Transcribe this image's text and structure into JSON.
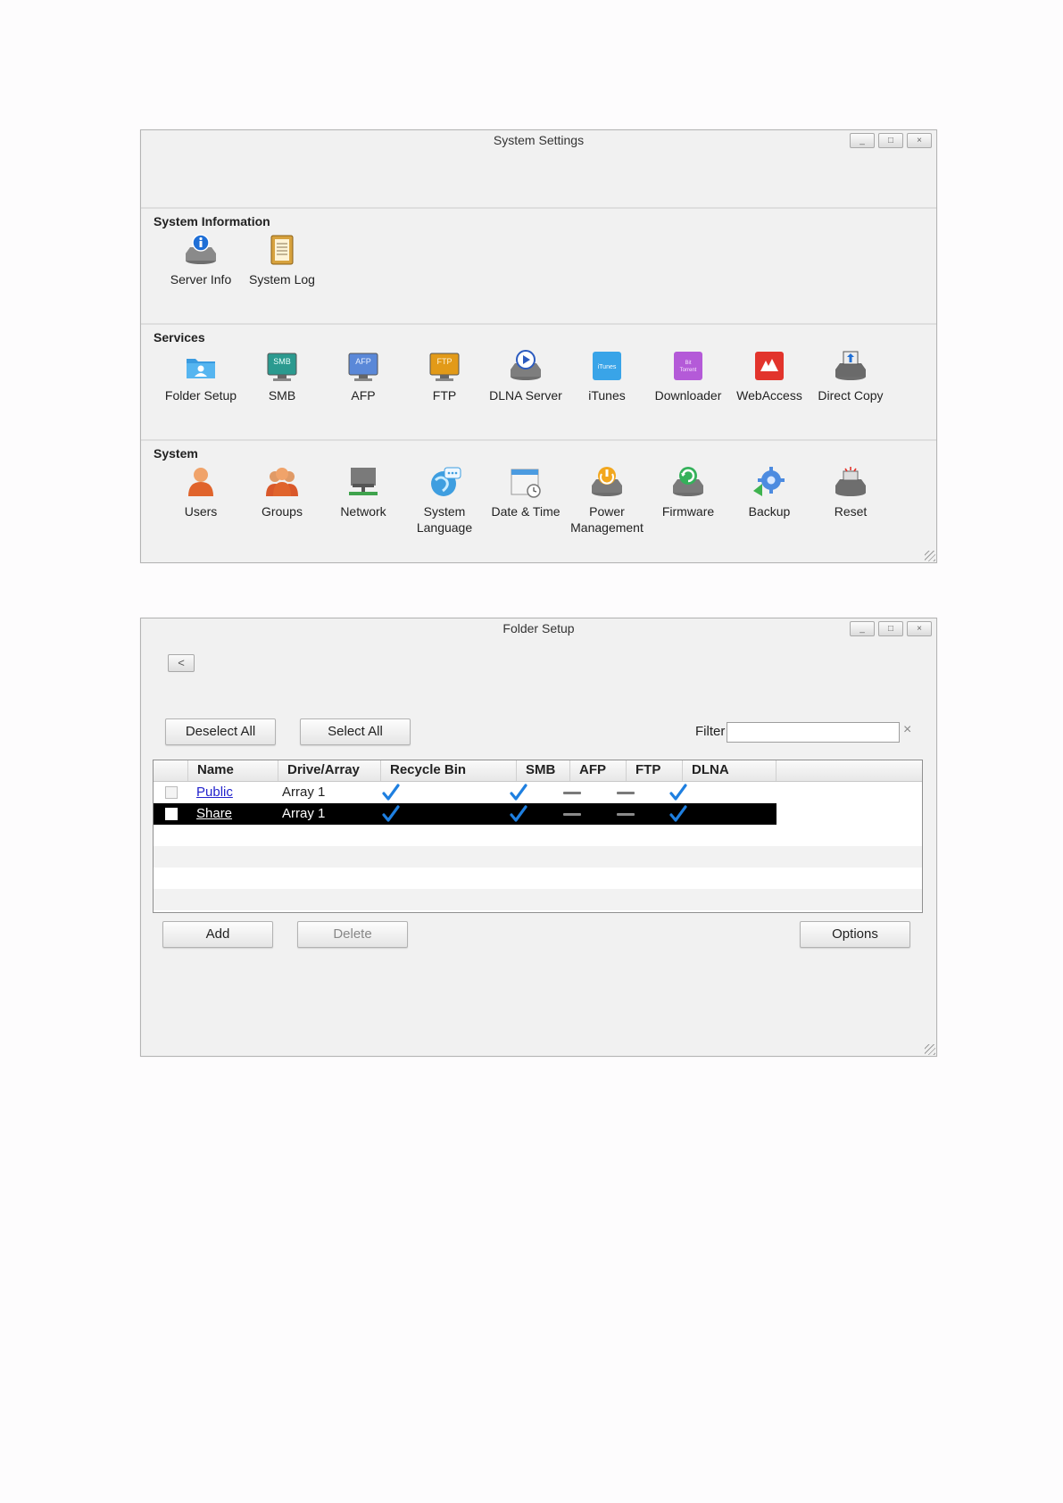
{
  "win1": {
    "title": "System Settings",
    "sections": [
      {
        "title": "System Information",
        "items": [
          {
            "label": "Server Info",
            "icon": "server-info-icon"
          },
          {
            "label": "System Log",
            "icon": "system-log-icon"
          }
        ]
      },
      {
        "title": "Services",
        "items": [
          {
            "label": "Folder Setup",
            "icon": "folder-setup-icon"
          },
          {
            "label": "SMB",
            "icon": "smb-icon",
            "badge": "SMB"
          },
          {
            "label": "AFP",
            "icon": "afp-icon",
            "badge": "AFP"
          },
          {
            "label": "FTP",
            "icon": "ftp-icon",
            "badge": "FTP"
          },
          {
            "label": "DLNA Server",
            "icon": "dlna-server-icon"
          },
          {
            "label": "iTunes",
            "icon": "itunes-icon",
            "badge": "iTunes"
          },
          {
            "label": "Downloader",
            "icon": "downloader-icon",
            "badge": "Bit Torrent"
          },
          {
            "label": "WebAccess",
            "icon": "webaccess-icon"
          },
          {
            "label": "Direct Copy",
            "icon": "direct-copy-icon"
          }
        ]
      },
      {
        "title": "System",
        "items": [
          {
            "label": "Users",
            "icon": "users-icon"
          },
          {
            "label": "Groups",
            "icon": "groups-icon"
          },
          {
            "label": "Network",
            "icon": "network-icon"
          },
          {
            "label": "System\nLanguage",
            "icon": "system-language-icon"
          },
          {
            "label": "Date & Time",
            "icon": "date-time-icon"
          },
          {
            "label": "Power\nManagement",
            "icon": "power-management-icon"
          },
          {
            "label": "Firmware",
            "icon": "firmware-icon"
          },
          {
            "label": "Backup",
            "icon": "backup-icon"
          },
          {
            "label": "Reset",
            "icon": "reset-icon"
          }
        ]
      }
    ]
  },
  "win2": {
    "title": "Folder Setup",
    "back_label": "<",
    "deselect_all": "Deselect All",
    "select_all": "Select All",
    "filter_label": "Filter",
    "filter_value": "",
    "filter_clear": "×",
    "columns": [
      "Name",
      "Drive/Array",
      "Recycle Bin",
      "SMB",
      "AFP",
      "FTP",
      "DLNA"
    ],
    "rows": [
      {
        "name": "Public",
        "drive": "Array 1",
        "recycle": "check",
        "smb": "check",
        "afp": "dash",
        "ftp": "dash",
        "dlna": "check",
        "selected": false
      },
      {
        "name": "Share",
        "drive": "Array 1",
        "recycle": "check",
        "smb": "check",
        "afp": "dash",
        "ftp": "dash",
        "dlna": "check",
        "selected": true
      }
    ],
    "add": "Add",
    "delete": "Delete",
    "options": "Options"
  },
  "window_buttons": [
    "_",
    "□",
    "×"
  ],
  "colors": {
    "check": "#1e7fe0",
    "dash": "#7a7a7a",
    "selected_row": "#000000",
    "link": "#2222cc"
  }
}
